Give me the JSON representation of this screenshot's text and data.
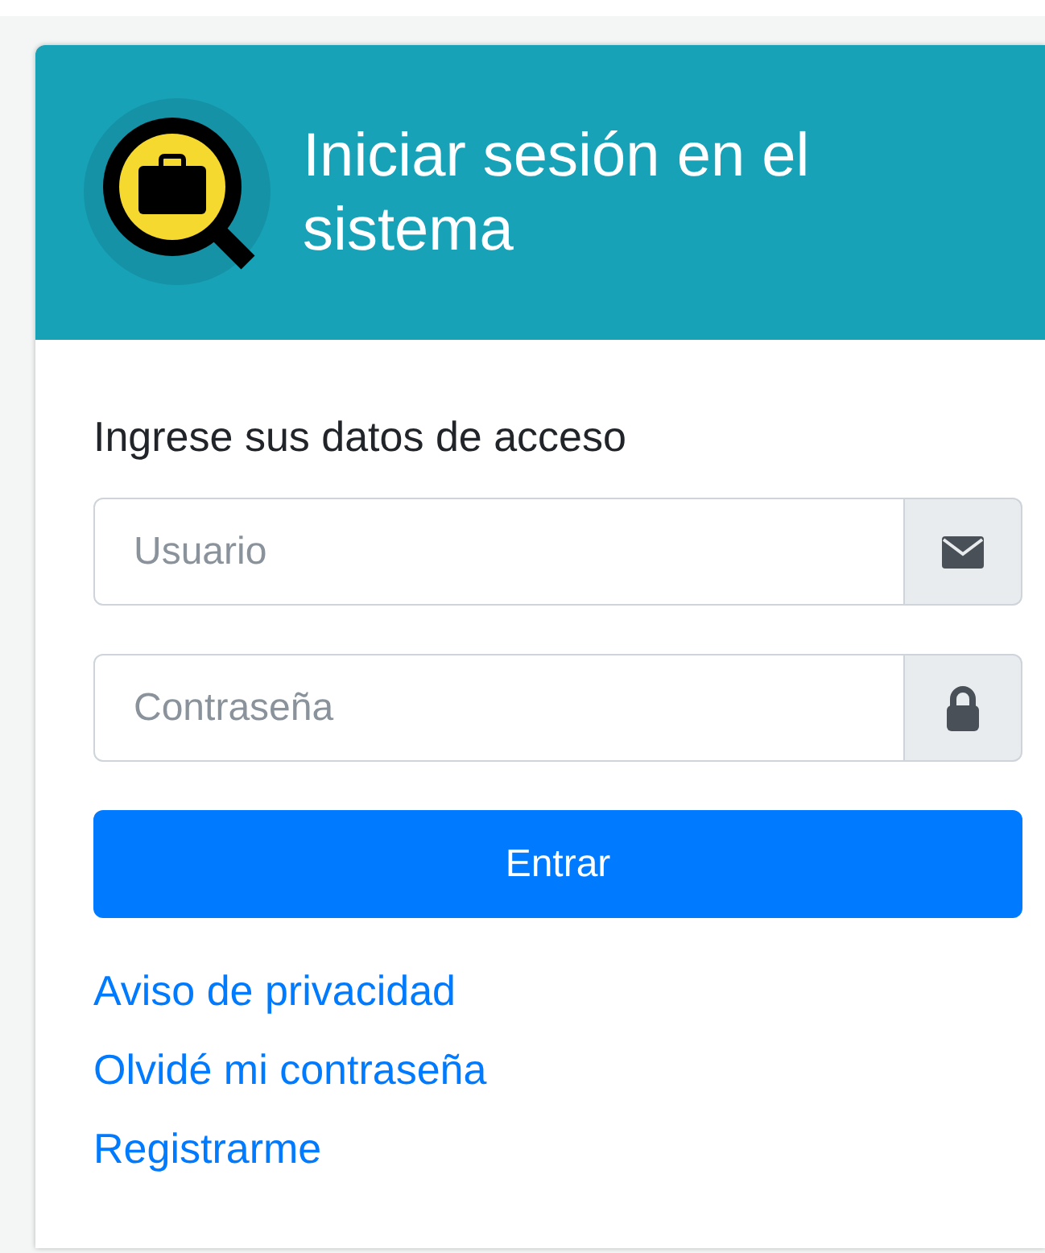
{
  "header": {
    "title": "Iniciar sesión en el sistema"
  },
  "form": {
    "heading": "Ingrese sus datos de acceso",
    "fields": [
      {
        "kind": "user",
        "placeholder": "Usuario"
      },
      {
        "kind": "password",
        "placeholder": "Contraseña"
      }
    ],
    "submit": "Entrar"
  },
  "links": [
    "Aviso de privacidad",
    "Olvidé mi contraseña",
    "Registrarme"
  ]
}
